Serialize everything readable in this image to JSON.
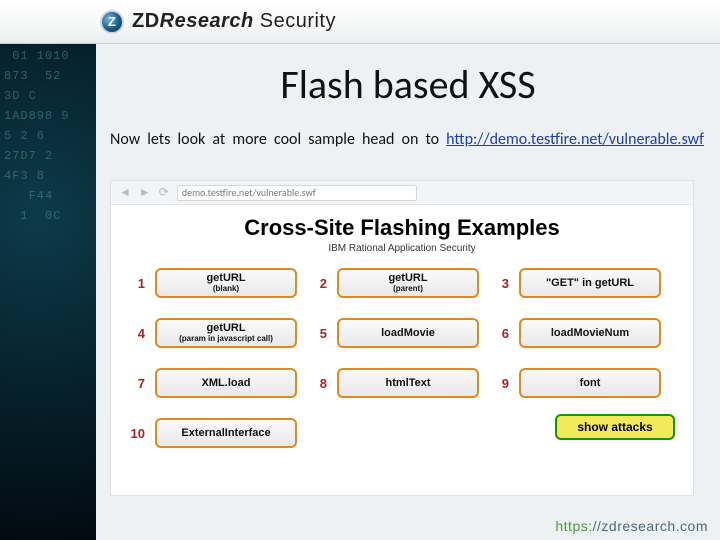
{
  "brand": {
    "part1": "ZD",
    "part2": "Research",
    "part3": "Security"
  },
  "title": "Flash based XSS",
  "intro_text": "Now lets look at more cool sample head on to ",
  "intro_link": "http://demo.testfire.net/vulnerable.swf",
  "screenshot": {
    "address": "demo.testfire.net/vulnerable.swf",
    "heading": "Cross-Site Flashing Examples",
    "subheading": "IBM Rational Application Security",
    "cells": [
      {
        "n": "1",
        "label": "getURL",
        "sub": "(blank)"
      },
      {
        "n": "2",
        "label": "getURL",
        "sub": "(parent)"
      },
      {
        "n": "3",
        "label": "\"GET\" in getURL",
        "sub": ""
      },
      {
        "n": "4",
        "label": "getURL",
        "sub": "(param in javascript call)"
      },
      {
        "n": "5",
        "label": "loadMovie",
        "sub": ""
      },
      {
        "n": "6",
        "label": "loadMovieNum",
        "sub": ""
      },
      {
        "n": "7",
        "label": "XML.load",
        "sub": ""
      },
      {
        "n": "8",
        "label": "htmlText",
        "sub": ""
      },
      {
        "n": "9",
        "label": "font",
        "sub": ""
      },
      {
        "n": "10",
        "label": "ExternalInterface",
        "sub": ""
      }
    ],
    "show_attacks": "show attacks"
  },
  "footer": {
    "https": "https:",
    "rest": "//zdresearch.com"
  },
  "sidebar_noise": " 01 1010\n873  52\n3D C\n1AD898 9\n5 2 6\n27D7 2\n4F3 8\n   F44\n  1  0C"
}
